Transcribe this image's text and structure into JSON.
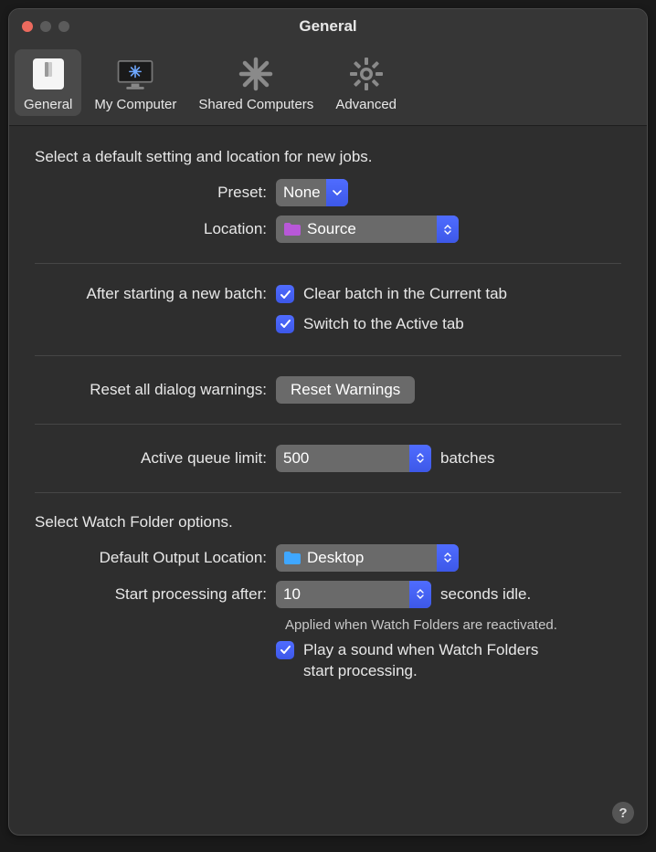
{
  "window": {
    "title": "General"
  },
  "tabs": [
    {
      "label": "General"
    },
    {
      "label": "My Computer"
    },
    {
      "label": "Shared Computers"
    },
    {
      "label": "Advanced"
    }
  ],
  "section_default": {
    "intro": "Select a default setting and location for new jobs.",
    "preset_label": "Preset:",
    "preset_value": "None",
    "location_label": "Location:",
    "location_value": "Source"
  },
  "section_batch": {
    "label": "After starting a new batch:",
    "opt_clear": "Clear batch in the Current tab",
    "opt_switch": "Switch to the Active tab"
  },
  "section_reset": {
    "label": "Reset all dialog warnings:",
    "button": "Reset Warnings"
  },
  "section_queue": {
    "label": "Active queue limit:",
    "value": "500",
    "suffix": "batches"
  },
  "section_watch": {
    "intro": "Select Watch Folder options.",
    "output_label": "Default Output Location:",
    "output_value": "Desktop",
    "start_label": "Start processing after:",
    "start_value": "10",
    "start_suffix": "seconds idle.",
    "hint": "Applied when Watch Folders are reactivated.",
    "sound_opt": "Play a sound when Watch Folders start processing."
  },
  "help_glyph": "?"
}
